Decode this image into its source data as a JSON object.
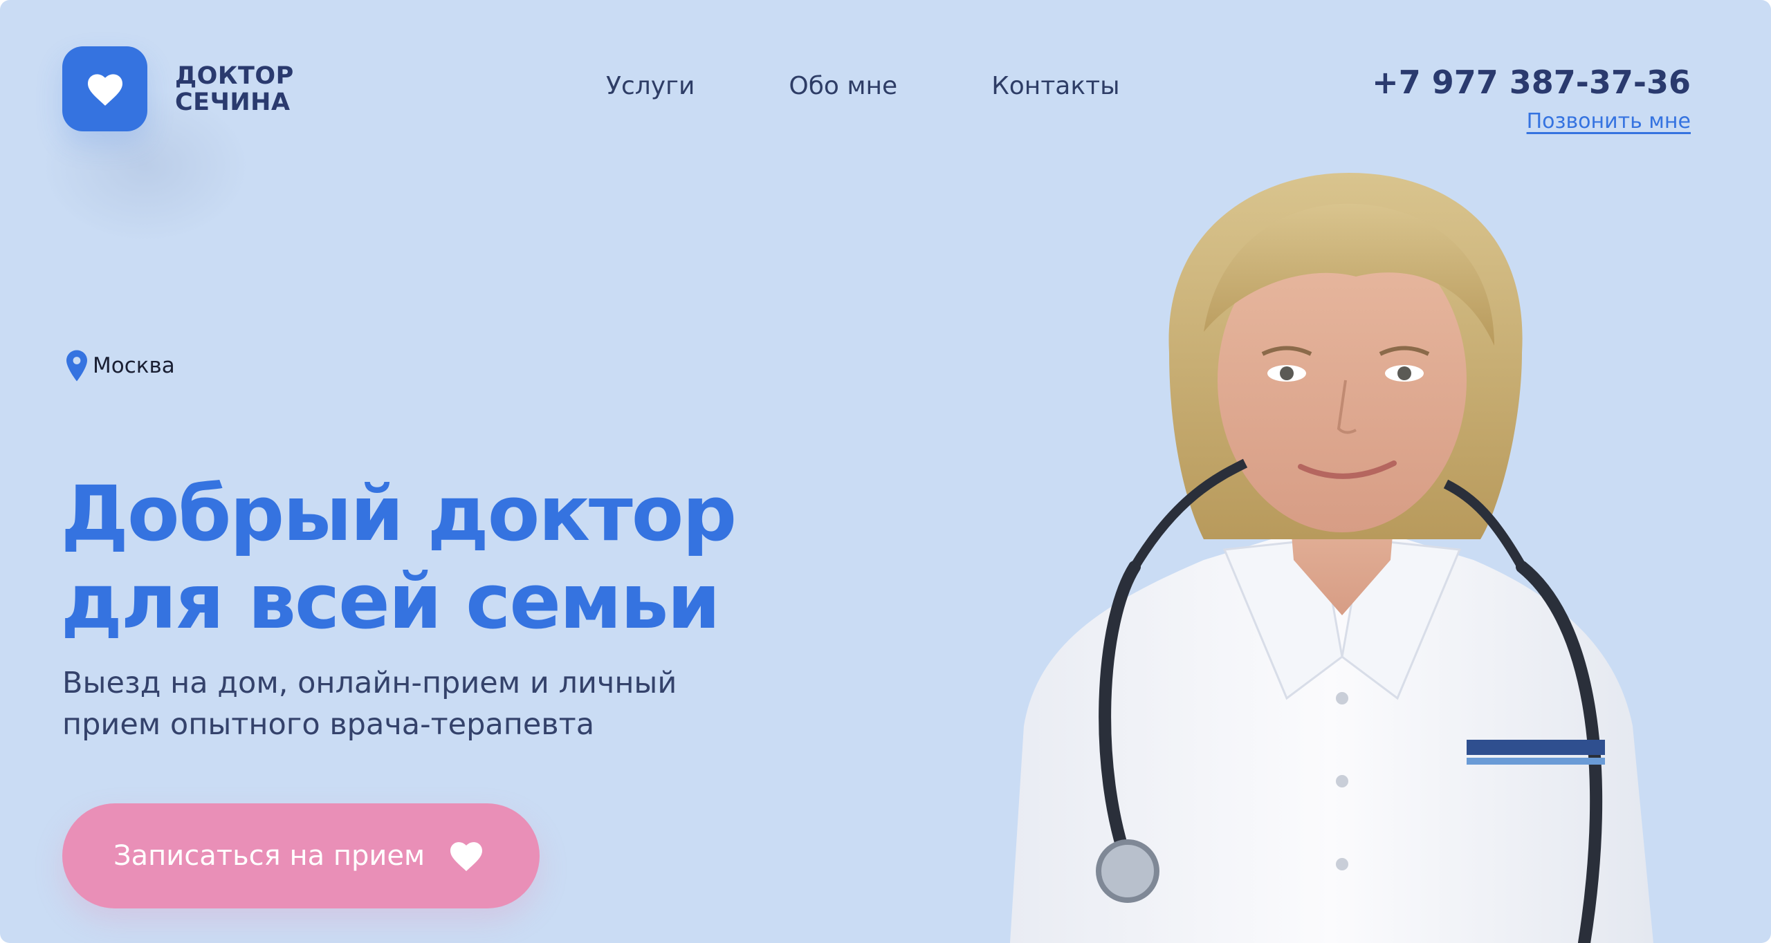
{
  "brand": {
    "line1": "ДОКТОР",
    "line2": "СЕЧИНА",
    "icon": "heart-icon",
    "accent_color": "#3573e0"
  },
  "nav": {
    "items": [
      {
        "label": "Услуги"
      },
      {
        "label": "Обо мне"
      },
      {
        "label": "Контакты"
      }
    ]
  },
  "contact": {
    "phone": "+7 977 387-37-36",
    "call_label": "Позвонить мне"
  },
  "location": {
    "icon": "map-pin-icon",
    "city": "Москва"
  },
  "hero": {
    "headline_line1": "Добрый доктор",
    "headline_line2": "для всей семьи",
    "subtitle_line1": "Выезд на дом, онлайн-прием и личный",
    "subtitle_line2": "прием опытного врача-терапевта",
    "cta_label": "Записаться на прием",
    "cta_icon": "heart-icon",
    "cta_color": "#e98fb7"
  },
  "portrait": {
    "icon": "doctor-photo"
  },
  "colors": {
    "background": "#cadcf4",
    "text_dark": "#2a3a6e"
  }
}
